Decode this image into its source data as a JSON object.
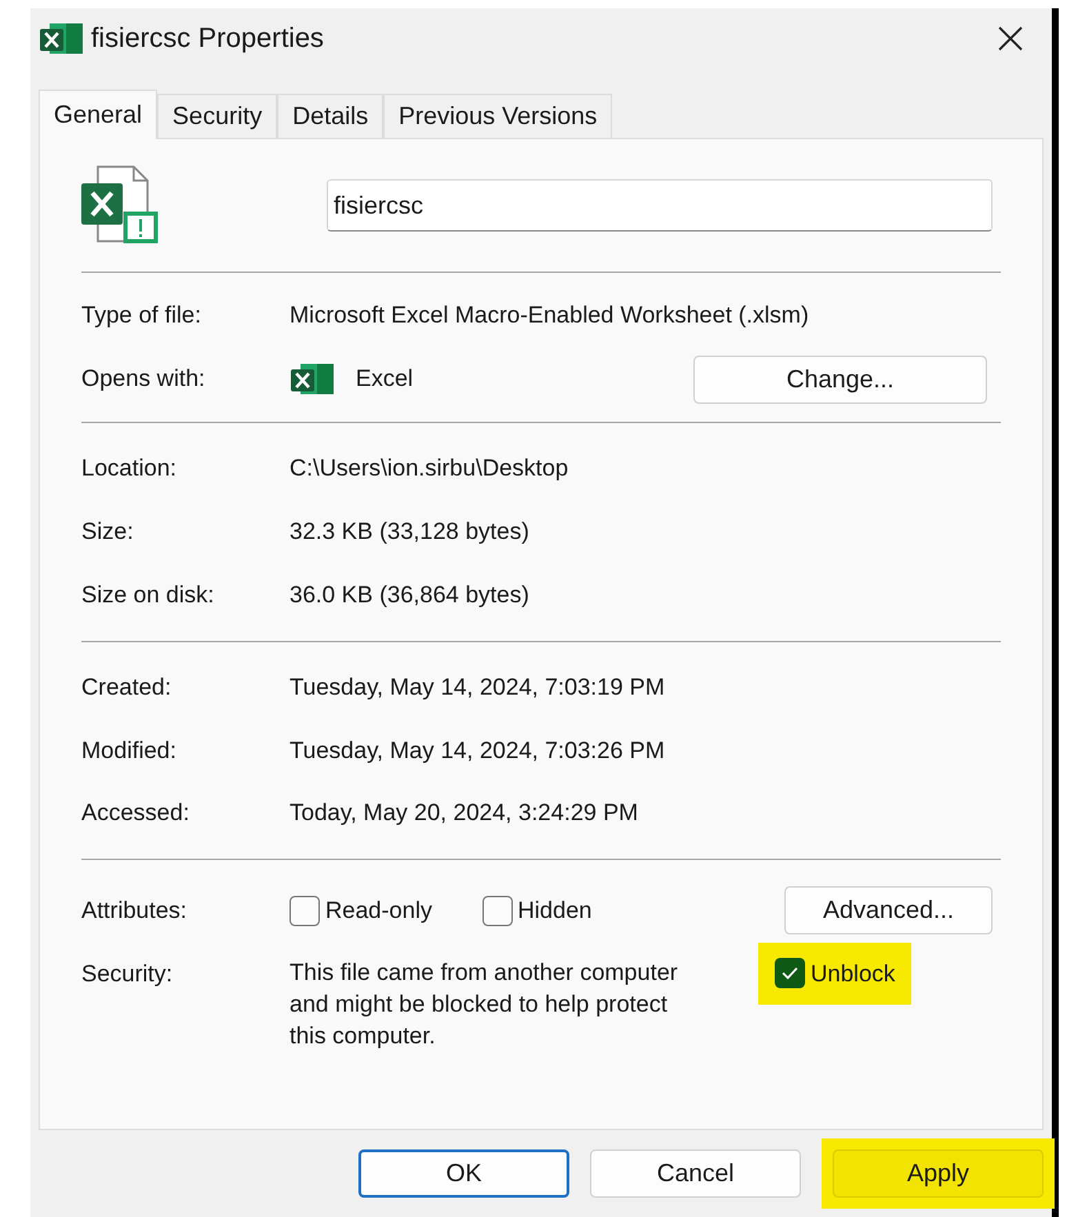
{
  "window": {
    "title": "fisiercsc Properties"
  },
  "tabs": [
    {
      "label": "General",
      "selected": true
    },
    {
      "label": "Security",
      "selected": false
    },
    {
      "label": "Details",
      "selected": false
    },
    {
      "label": "Previous Versions",
      "selected": false
    }
  ],
  "file_name": {
    "value": "fisiercsc"
  },
  "type_section": [
    {
      "label": "Type of file:",
      "value": "Microsoft Excel Macro-Enabled Worksheet (.xlsm)"
    },
    {
      "label": "Opens with:",
      "value": "Excel",
      "button": "Change..."
    }
  ],
  "location_section": [
    {
      "label": "Location:",
      "value": "C:\\Users\\ion.sirbu\\Desktop"
    },
    {
      "label": "Size:",
      "value": "32.3 KB (33,128 bytes)"
    },
    {
      "label": "Size on disk:",
      "value": "36.0 KB (36,864 bytes)"
    }
  ],
  "dates_section": [
    {
      "label": "Created:",
      "value": "Tuesday, May 14, 2024, 7:03:19 PM"
    },
    {
      "label": "Modified:",
      "value": "Tuesday, May 14, 2024, 7:03:26 PM"
    },
    {
      "label": "Accessed:",
      "value": "Today, May 20, 2024, 3:24:29 PM"
    }
  ],
  "attributes": {
    "label": "Attributes:",
    "checkboxes": [
      {
        "label": "Read-only",
        "checked": false
      },
      {
        "label": "Hidden",
        "checked": false
      }
    ],
    "button": "Advanced..."
  },
  "security": {
    "label": "Security:",
    "lines": [
      "This file came from another computer",
      "and might be blocked to help protect",
      "this computer."
    ],
    "unblock": {
      "label": "Unblock",
      "checked": true,
      "highlighted": true
    }
  },
  "buttons": [
    {
      "label": "OK",
      "default": true,
      "highlighted": false
    },
    {
      "label": "Cancel",
      "default": false,
      "highlighted": false
    },
    {
      "label": "Apply",
      "default": false,
      "highlighted": true
    }
  ]
}
